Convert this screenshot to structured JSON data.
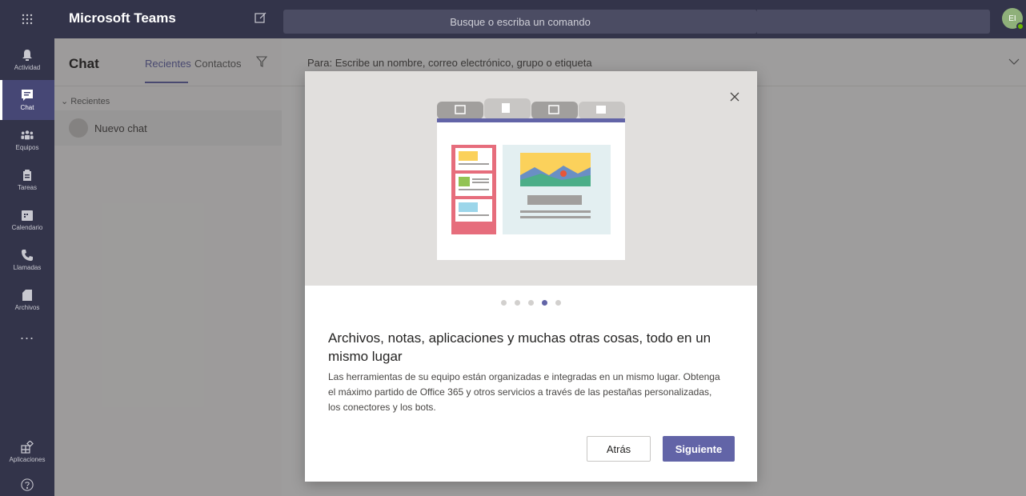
{
  "app": {
    "title": "Microsoft Teams"
  },
  "search": {
    "placeholder": "Busque o escriba un comando"
  },
  "user": {
    "initials": "EI"
  },
  "rail": {
    "items": [
      {
        "label": "Actividad",
        "icon": "bell-icon"
      },
      {
        "label": "Chat",
        "icon": "chat-icon"
      },
      {
        "label": "Equipos",
        "icon": "teams-icon"
      },
      {
        "label": "Tareas",
        "icon": "tasks-icon"
      },
      {
        "label": "Calendario",
        "icon": "calendar-icon"
      },
      {
        "label": "Llamadas",
        "icon": "phone-icon"
      },
      {
        "label": "Archivos",
        "icon": "files-icon"
      }
    ],
    "more": "...",
    "apps_label": "Aplicaciones",
    "active": "Chat"
  },
  "chat_list": {
    "title": "Chat",
    "tabs": [
      "Recientes",
      "Contactos"
    ],
    "section": "Recientes",
    "items": [
      {
        "name": "Nuevo chat"
      }
    ]
  },
  "compose": {
    "to_label": "Para:",
    "to_placeholder": "Escribe un nombre, correo electrónico, grupo o etiqueta"
  },
  "modal": {
    "title": "Archivos, notas, aplicaciones y muchas otras cosas, todo en un mismo lugar",
    "body": "Las herramientas de su equipo están organizadas e integradas en un mismo lugar. Obtenga el máximo partido de Office 365 y otros servicios a través de las pestañas personalizadas, los conectores y los bots.",
    "back_label": "Atrás",
    "next_label": "Siguiente",
    "page_count": 5,
    "active_page": 4
  },
  "colors": {
    "accent": "#6264a7",
    "rail_bg": "#33344a",
    "hero_bg": "#e1dfdd"
  }
}
